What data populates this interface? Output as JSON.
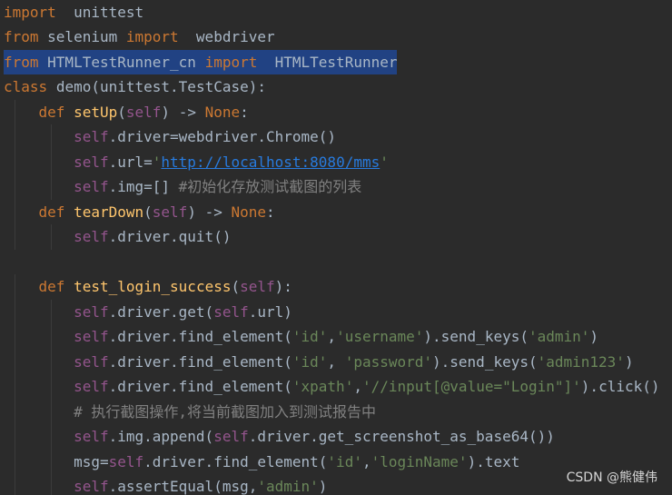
{
  "editor": {
    "theme_colors": {
      "background": "#2b2b2b",
      "keyword": "#cc7832",
      "self": "#94558d",
      "function": "#ffc66d",
      "string": "#6a8759",
      "url": "#287bde",
      "comment": "#808080",
      "default": "#a9b7c6",
      "selection": "#214283"
    },
    "selected_line": 3,
    "lines": [
      [
        [
          "kw",
          "import"
        ],
        [
          "plain",
          "  unittest"
        ]
      ],
      [
        [
          "kw",
          "from"
        ],
        [
          "plain",
          " selenium "
        ],
        [
          "kw",
          "import"
        ],
        [
          "plain",
          "  webdriver"
        ]
      ],
      [
        [
          "kw",
          "from"
        ],
        [
          "plain",
          " HTMLTestRunner_cn "
        ],
        [
          "kw",
          "import"
        ],
        [
          "plain",
          "  HTMLTestRunner"
        ]
      ],
      [
        [
          "kw",
          "class"
        ],
        [
          "plain",
          " "
        ],
        [
          "cls",
          "demo"
        ],
        [
          "plain",
          "(unittest.TestCase):"
        ]
      ],
      [
        [
          "plain",
          "    "
        ],
        [
          "kw",
          "def"
        ],
        [
          "plain",
          " "
        ],
        [
          "fn",
          "setUp"
        ],
        [
          "plain",
          "("
        ],
        [
          "self",
          "self"
        ],
        [
          "plain",
          ") -> "
        ],
        [
          "kw",
          "None"
        ],
        [
          "plain",
          ":"
        ]
      ],
      [
        [
          "plain",
          "        "
        ],
        [
          "self",
          "self"
        ],
        [
          "plain",
          ".driver=webdriver.Chrome()"
        ]
      ],
      [
        [
          "plain",
          "        "
        ],
        [
          "self",
          "self"
        ],
        [
          "plain",
          ".url="
        ],
        [
          "str",
          "'"
        ],
        [
          "url",
          "http://localhost:8080/mms"
        ],
        [
          "str",
          "'"
        ]
      ],
      [
        [
          "plain",
          "        "
        ],
        [
          "self",
          "self"
        ],
        [
          "plain",
          ".img=[] "
        ],
        [
          "cm",
          "#初始化存放测试截图的列表"
        ]
      ],
      [
        [
          "plain",
          "    "
        ],
        [
          "kw",
          "def"
        ],
        [
          "plain",
          " "
        ],
        [
          "fn",
          "tearDown"
        ],
        [
          "plain",
          "("
        ],
        [
          "self",
          "self"
        ],
        [
          "plain",
          ") -> "
        ],
        [
          "kw",
          "None"
        ],
        [
          "plain",
          ":"
        ]
      ],
      [
        [
          "plain",
          "        "
        ],
        [
          "self",
          "self"
        ],
        [
          "plain",
          ".driver.quit()"
        ]
      ],
      [],
      [
        [
          "plain",
          "    "
        ],
        [
          "kw",
          "def"
        ],
        [
          "plain",
          " "
        ],
        [
          "fn",
          "test_login_success"
        ],
        [
          "plain",
          "("
        ],
        [
          "self",
          "self"
        ],
        [
          "plain",
          "):"
        ]
      ],
      [
        [
          "plain",
          "        "
        ],
        [
          "self",
          "self"
        ],
        [
          "plain",
          ".driver.get("
        ],
        [
          "self",
          "self"
        ],
        [
          "plain",
          ".url)"
        ]
      ],
      [
        [
          "plain",
          "        "
        ],
        [
          "self",
          "self"
        ],
        [
          "plain",
          ".driver.find_element("
        ],
        [
          "str",
          "'id'"
        ],
        [
          "plain",
          ","
        ],
        [
          "str",
          "'username'"
        ],
        [
          "plain",
          ").send_keys("
        ],
        [
          "str",
          "'admin'"
        ],
        [
          "plain",
          ")"
        ]
      ],
      [
        [
          "plain",
          "        "
        ],
        [
          "self",
          "self"
        ],
        [
          "plain",
          ".driver.find_element("
        ],
        [
          "str",
          "'id'"
        ],
        [
          "plain",
          ", "
        ],
        [
          "str",
          "'password'"
        ],
        [
          "plain",
          ").send_keys("
        ],
        [
          "str",
          "'admin123'"
        ],
        [
          "plain",
          ")"
        ]
      ],
      [
        [
          "plain",
          "        "
        ],
        [
          "self",
          "self"
        ],
        [
          "plain",
          ".driver.find_element("
        ],
        [
          "str",
          "'xpath'"
        ],
        [
          "plain",
          ","
        ],
        [
          "str",
          "'//input[@value=\"Login\"]'"
        ],
        [
          "plain",
          ").click()"
        ]
      ],
      [
        [
          "plain",
          "        "
        ],
        [
          "cm",
          "# 执行截图操作,将当前截图加入到测试报告中"
        ]
      ],
      [
        [
          "plain",
          "        "
        ],
        [
          "self",
          "self"
        ],
        [
          "plain",
          ".img.append("
        ],
        [
          "self",
          "self"
        ],
        [
          "plain",
          ".driver.get_screenshot_as_base64())"
        ]
      ],
      [
        [
          "plain",
          "        msg="
        ],
        [
          "self",
          "self"
        ],
        [
          "plain",
          ".driver.find_element("
        ],
        [
          "str",
          "'id'"
        ],
        [
          "plain",
          ","
        ],
        [
          "str",
          "'loginName'"
        ],
        [
          "plain",
          ").text"
        ]
      ],
      [
        [
          "plain",
          "        "
        ],
        [
          "self",
          "self"
        ],
        [
          "plain",
          ".assertEqual(msg,"
        ],
        [
          "str",
          "'admin'"
        ],
        [
          "plain",
          ")"
        ]
      ]
    ]
  },
  "watermark": "CSDN @熊健伟"
}
